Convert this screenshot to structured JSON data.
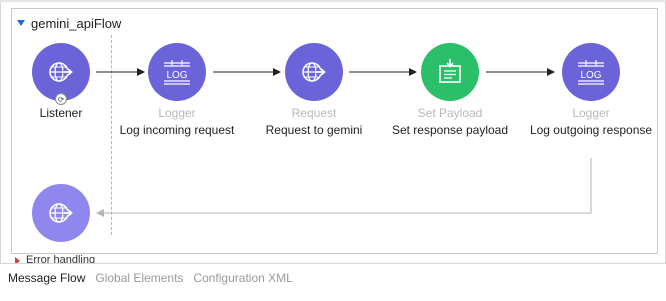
{
  "flow": {
    "name": "gemini_apiFlow",
    "nodes": [
      {
        "type": "",
        "name": "Listener",
        "icon": "globe-arrow-icon",
        "color": "#6b63d8"
      },
      {
        "type": "Logger",
        "name": "Log incoming request",
        "icon": "log-icon",
        "color": "#6b63d8"
      },
      {
        "type": "Request",
        "name": "Request to gemini",
        "icon": "globe-arrow-icon",
        "color": "#6b63d8"
      },
      {
        "type": "Set Payload",
        "name": "Set response payload",
        "icon": "set-payload-icon",
        "color": "#2bbf6a"
      },
      {
        "type": "Logger",
        "name": "Log outgoing response",
        "icon": "log-icon",
        "color": "#6b63d8"
      }
    ],
    "log_glyph": "LOG",
    "error_handling_label": "Error handling"
  },
  "tabs": {
    "message_flow": "Message Flow",
    "global_elements": "Global Elements",
    "configuration_xml": "Configuration XML"
  }
}
